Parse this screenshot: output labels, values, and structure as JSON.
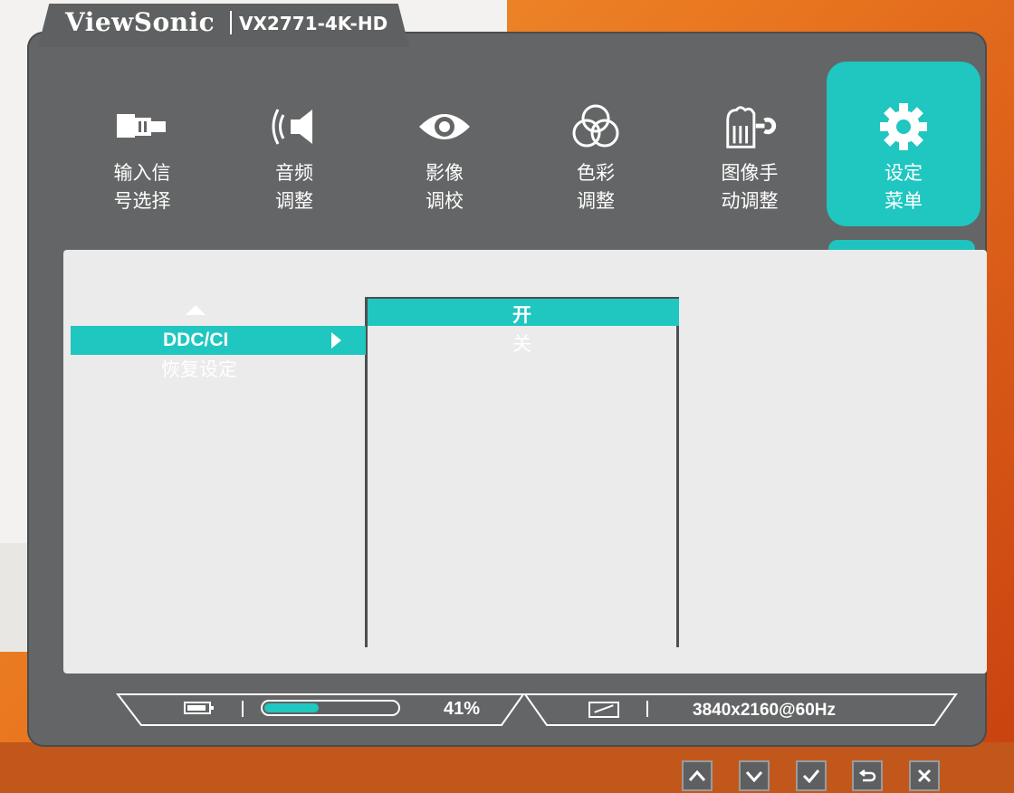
{
  "brand": {
    "logo": "ViewSonic",
    "model": "VX2771-4K-HD"
  },
  "menu": {
    "tabs": [
      {
        "line1": "输入信",
        "line2": "号选择",
        "icon": "input-source-icon"
      },
      {
        "line1": "音频",
        "line2": "调整",
        "icon": "speaker-icon"
      },
      {
        "line1": "影像",
        "line2": "调校",
        "icon": "eye-icon"
      },
      {
        "line1": "色彩",
        "line2": "调整",
        "icon": "color-circles-icon"
      },
      {
        "line1": "图像手",
        "line2": "动调整",
        "icon": "manual-image-adjust-icon"
      },
      {
        "line1": "设定",
        "line2": "菜单",
        "icon": "gear-icon",
        "active": true
      }
    ]
  },
  "submenu": {
    "items": [
      {
        "label": "DDC/CI",
        "selected": true
      },
      {
        "label": "恢复设定"
      }
    ]
  },
  "options": {
    "items": [
      {
        "label": "开",
        "selected": true
      },
      {
        "label": "关"
      }
    ]
  },
  "status": {
    "level_percent": 41,
    "level_text": "41%",
    "resolution": "3840x2160@60Hz"
  },
  "colors": {
    "accent": "#20c6c0",
    "osd_bg": "#646566",
    "content_bg": "#ebebec"
  },
  "hardware_buttons": [
    "up-arrow-icon",
    "down-arrow-icon",
    "check-icon",
    "return-icon",
    "close-icon"
  ]
}
